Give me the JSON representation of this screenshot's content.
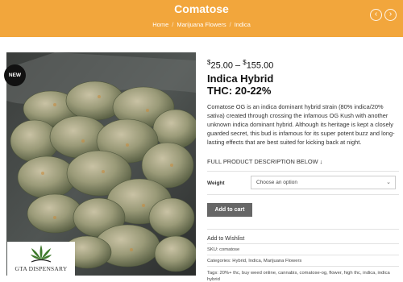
{
  "header": {
    "title": "Comatose",
    "breadcrumb": [
      "Home",
      "Marijuana Flowers",
      "Indica"
    ],
    "breadcrumb_sep": "/",
    "prev_icon": "chevron-left-icon",
    "next_icon": "chevron-right-icon"
  },
  "image": {
    "badge": "NEW",
    "logo_text": "GTA DISPENSARY",
    "logo_icon": "cannabis-leaf-icon"
  },
  "product": {
    "price_min": "25.00",
    "price_sep": "–",
    "price_max": "155.00",
    "currency": "$",
    "title_line1": "Indica Hybrid",
    "title_line2": "THC: 20-22%",
    "description": "Comatose OG is an indica dominant hybrid strain (80% indica/20% sativa) created through crossing the infamous OG Kush with another unknown indica dominant hybrid. Although its heritage is kept a closely guarded secret, this bud is infamous for its super potent buzz and long-lasting effects that are best suited for kicking back at night.",
    "full_desc_link": "FULL PRODUCT DESCRIPTION BELOW ↓"
  },
  "form": {
    "weight_label": "Weight",
    "weight_placeholder": "Choose an option",
    "add_to_cart": "Add to cart"
  },
  "meta": {
    "wishlist": "Add to Wishlist",
    "sku": "SKU: comatose",
    "categories": "Categories: Hybrid, Indica, Marijuana Flowers",
    "tags": "Tags: 20%+ thc, buy weed online, cannabis, comatose-og, flower, high thc, indica, indica hybrid"
  },
  "colors": {
    "header_bg": "#f2a63c",
    "button_bg": "#666666",
    "badge_bg": "#111111"
  }
}
